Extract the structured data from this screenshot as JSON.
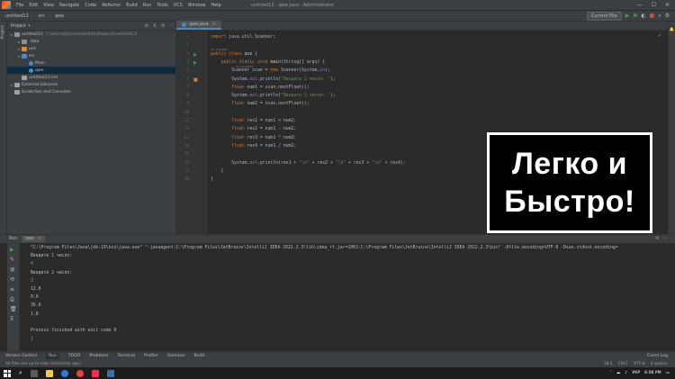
{
  "menu": {
    "items": [
      "File",
      "Edit",
      "View",
      "Navigate",
      "Code",
      "Refactor",
      "Build",
      "Run",
      "Tools",
      "VCS",
      "Window",
      "Help"
    ],
    "window_title": "untitled13 - qwe.java - Administrator",
    "controls": [
      "—",
      "☐",
      "✕"
    ]
  },
  "navbar": {
    "crumbs": [
      "untitled13",
      "src",
      "qwe"
    ],
    "run_config": "Current File"
  },
  "project": {
    "header": "Project",
    "tree": [
      {
        "label": "untitled13",
        "path": "C:\\Users\\Documents\\IdeaProjects\\untitled13",
        "indent": 0,
        "icon": "folder-icon",
        "color": "#87939a",
        "expanded": true
      },
      {
        "label": ".idea",
        "indent": 1,
        "icon": "folder-icon",
        "color": "#87939a",
        "expanded": false
      },
      {
        "label": "out",
        "indent": 1,
        "icon": "folder-icon",
        "color": "#d88a3a",
        "expanded": false
      },
      {
        "label": "src",
        "indent": 1,
        "icon": "folder-icon",
        "color": "#4a88c7",
        "expanded": true
      },
      {
        "label": "Main",
        "indent": 2,
        "icon": "class-icon",
        "color": "#4a88c7",
        "expanded": null
      },
      {
        "label": "qwe",
        "indent": 2,
        "icon": "class-icon",
        "color": "#4a88c7",
        "expanded": null,
        "selected": true
      },
      {
        "label": "untitled13.iml",
        "indent": 1,
        "icon": "file-icon",
        "color": "#a0a0a0",
        "expanded": null
      },
      {
        "label": "External Libraries",
        "indent": 0,
        "icon": "library-icon",
        "color": "#a0a0a0",
        "expanded": false
      },
      {
        "label": "Scratches and Consoles",
        "indent": 0,
        "icon": "scratch-icon",
        "color": "#a0a0a0",
        "expanded": null
      }
    ]
  },
  "editor": {
    "tab_label": "qwe.java",
    "line_numbers": [
      "1",
      "2",
      "3",
      "4",
      "5",
      "6",
      "7",
      "8",
      "9",
      "10",
      "11",
      "12",
      "13",
      "14",
      "15",
      "16",
      "17",
      "18"
    ],
    "hint_usages": "no usages",
    "lines": [
      [
        [
          "k",
          "import "
        ],
        [
          "t",
          "java.util.Scanner;"
        ]
      ],
      [
        [
          "t",
          ""
        ]
      ],
      [
        [
          "k",
          "public class "
        ],
        [
          "t",
          "qwe {"
        ]
      ],
      [
        [
          "t",
          "    "
        ],
        [
          "k",
          "public static void "
        ],
        [
          "f",
          "main"
        ],
        [
          "t",
          "(String[] args) {"
        ]
      ],
      [
        [
          "t",
          "        Scanner scan = "
        ],
        [
          "k",
          "new "
        ],
        [
          "t",
          "Scanner(System."
        ],
        [
          "st",
          "in"
        ],
        [
          "t",
          ");"
        ]
      ],
      [
        [
          "t",
          "        System."
        ],
        [
          "st",
          "out"
        ],
        [
          "t",
          ".println("
        ],
        [
          "s",
          "\"Введите 1 число: \""
        ],
        [
          "t",
          ");"
        ]
      ],
      [
        [
          "t",
          "        "
        ],
        [
          "k",
          "float "
        ],
        [
          "t",
          "num1 = scan.nextFloat();"
        ]
      ],
      [
        [
          "t",
          "        System."
        ],
        [
          "st",
          "out"
        ],
        [
          "t",
          ".println("
        ],
        [
          "s",
          "\"Введите 2 число: \""
        ],
        [
          "t",
          ");"
        ]
      ],
      [
        [
          "t",
          "        "
        ],
        [
          "k",
          "float "
        ],
        [
          "t",
          "num2 = scan.nextFloat();"
        ]
      ],
      [
        [
          "t",
          ""
        ]
      ],
      [
        [
          "t",
          "        "
        ],
        [
          "k",
          "float "
        ],
        [
          "t",
          "res1 = num1 + num2;"
        ]
      ],
      [
        [
          "t",
          "        "
        ],
        [
          "k",
          "float "
        ],
        [
          "t",
          "res2 = num1 - num2;"
        ]
      ],
      [
        [
          "t",
          "        "
        ],
        [
          "k",
          "float "
        ],
        [
          "t",
          "res3 = num1 * num2;"
        ]
      ],
      [
        [
          "t",
          "        "
        ],
        [
          "k",
          "float "
        ],
        [
          "t",
          "res4 = num1 / num2;"
        ]
      ],
      [
        [
          "t",
          ""
        ]
      ],
      [
        [
          "t",
          "        System."
        ],
        [
          "st",
          "out"
        ],
        [
          "t",
          ".println(res1 + "
        ],
        [
          "s",
          "\"\\n\""
        ],
        [
          "t",
          " + res2 + "
        ],
        [
          "s",
          "\"\\n\""
        ],
        [
          "t",
          " + res3 + "
        ],
        [
          "s",
          "\"\\n\""
        ],
        [
          "t",
          " + res4);"
        ]
      ],
      [
        [
          "t",
          "    }"
        ]
      ],
      [
        [
          "t",
          "}"
        ]
      ]
    ]
  },
  "overlay": {
    "line1": "Легко и",
    "line2": "Быстро!"
  },
  "run": {
    "tab": "qwe",
    "label": "Run:"
  },
  "console": {
    "lines": [
      {
        "text": "\"C:\\Program Files\\Java\\jdk-19\\bin\\java.exe\" \"-javaagent:C:\\Program Files\\JetBrains\\IntelliJ IDEA 2022.2.3\\lib\\idea_rt.jar=1063:C:\\Program Files\\JetBrains\\IntelliJ IDEA 2022.2.3\\bin\" -Dfile.encoding=UTF-8 -Dsun.stdout.encoding=",
        "input": false
      },
      {
        "text": "Введите 1 число:",
        "input": false
      },
      {
        "text": "4",
        "input": true
      },
      {
        "text": "Введите 2 число:",
        "input": false
      },
      {
        "text": "3",
        "input": true
      },
      {
        "text": "12.0",
        "input": false
      },
      {
        "text": "0.0",
        "input": false
      },
      {
        "text": "36.0",
        "input": false
      },
      {
        "text": "1.0",
        "input": false
      },
      {
        "text": "",
        "input": false
      },
      {
        "text": "Process finished with exit code 0",
        "input": false
      },
      {
        "text": "|",
        "input": false
      }
    ]
  },
  "tooltabs": {
    "items": [
      "Version Control",
      "Run",
      "TODO",
      "Problems",
      "Terminal",
      "Profiler",
      "Services",
      "Build"
    ],
    "active": "Run",
    "right": "Event Log"
  },
  "status": {
    "left": "All files are up-to-date (moments ago)",
    "right": [
      "18:1",
      "CRLF",
      "UTF-8",
      "4 spaces"
    ]
  },
  "taskbar": {
    "lang": "УКР",
    "time": "6:08 PM"
  },
  "colors": {
    "accent": "#4a88c7",
    "run_green": "#499c54",
    "keyword": "#cc7832",
    "string": "#6a8759"
  }
}
